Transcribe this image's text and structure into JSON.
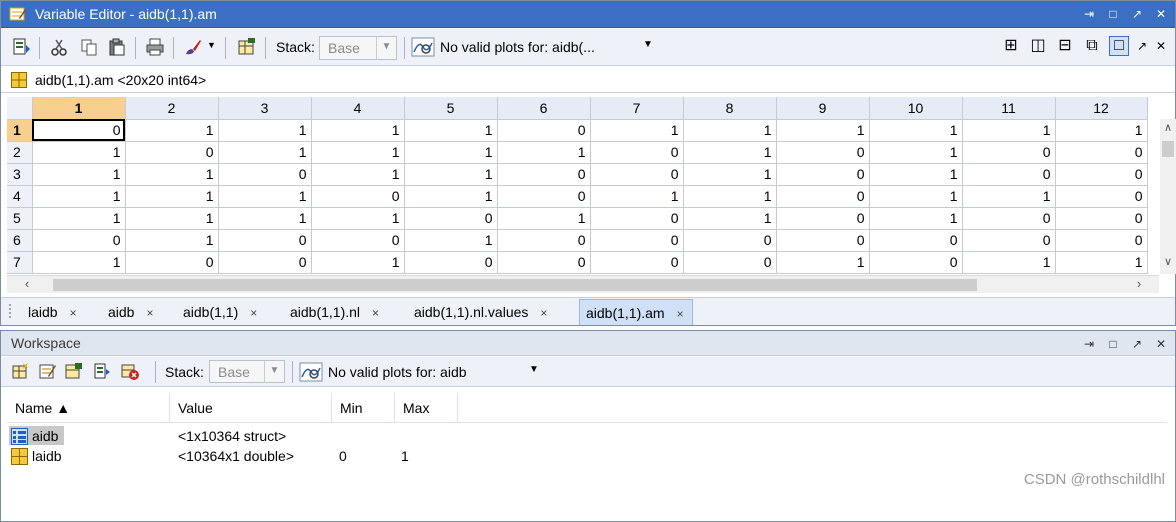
{
  "variable_editor": {
    "title": "Variable Editor - aidb(1,1).am",
    "window_controls": [
      "⇥",
      "□",
      "↗",
      "✕"
    ],
    "toolbar": {
      "stack_label": "Stack:",
      "stack_value": "Base",
      "plot_text": "No valid plots for: aidb(...",
      "layout_buttons": [
        "⊞",
        "◫",
        "⊟",
        "⧉",
        "□"
      ],
      "undock": "↗",
      "close": "✕"
    },
    "var_info": "aidb(1,1).am  <20x20 int64>",
    "grid": {
      "columns": [
        "1",
        "2",
        "3",
        "4",
        "5",
        "6",
        "7",
        "8",
        "9",
        "10",
        "11",
        "12"
      ],
      "row_headers": [
        "1",
        "2",
        "3",
        "4",
        "5",
        "6",
        "7"
      ],
      "rows": [
        [
          "0",
          "1",
          "1",
          "1",
          "1",
          "0",
          "1",
          "1",
          "1",
          "1",
          "1",
          "1"
        ],
        [
          "1",
          "0",
          "1",
          "1",
          "1",
          "1",
          "0",
          "1",
          "0",
          "1",
          "0",
          "0"
        ],
        [
          "1",
          "1",
          "0",
          "1",
          "1",
          "0",
          "0",
          "1",
          "0",
          "1",
          "0",
          "0"
        ],
        [
          "1",
          "1",
          "1",
          "0",
          "1",
          "0",
          "1",
          "1",
          "0",
          "1",
          "1",
          "0"
        ],
        [
          "1",
          "1",
          "1",
          "1",
          "0",
          "1",
          "0",
          "1",
          "0",
          "1",
          "0",
          "0"
        ],
        [
          "0",
          "1",
          "0",
          "0",
          "1",
          "0",
          "0",
          "0",
          "0",
          "0",
          "0",
          "0"
        ],
        [
          "1",
          "0",
          "0",
          "1",
          "0",
          "0",
          "0",
          "0",
          "1",
          "0",
          "1",
          "1"
        ]
      ],
      "selected_row": 0,
      "selected_col": 0
    },
    "doc_tabs": [
      {
        "label": "laidb",
        "close": "×"
      },
      {
        "label": "aidb",
        "close": "×"
      },
      {
        "label": "aidb(1,1)",
        "close": "×"
      },
      {
        "label": "aidb(1,1).nl",
        "close": "×"
      },
      {
        "label": "aidb(1,1).nl.values",
        "close": "×"
      },
      {
        "label": "aidb(1,1).am",
        "close": "×",
        "active": true
      }
    ]
  },
  "workspace": {
    "title": "Workspace",
    "window_controls": [
      "⇥",
      "□",
      "↗",
      "✕"
    ],
    "toolbar": {
      "stack_label": "Stack:",
      "stack_value": "Base",
      "plot_text": "No valid plots for: aidb"
    },
    "columns": [
      "Name ▲",
      "Value",
      "Min",
      "Max"
    ],
    "rows": [
      {
        "name": "aidb",
        "value": "<1x10364 struct>",
        "min": "",
        "max": "",
        "icon": "struct-icon",
        "selected": true
      },
      {
        "name": "laidb",
        "value": "<10364x1 double>",
        "min": "0",
        "max": "1",
        "icon": "matrix-icon",
        "selected": false
      }
    ]
  },
  "watermark": "CSDN @rothschildlhl",
  "colors": {
    "title_bar": "#3b6fc4",
    "selected_header": "#f7d08f",
    "toolbar_bg": "#eef2f8"
  }
}
